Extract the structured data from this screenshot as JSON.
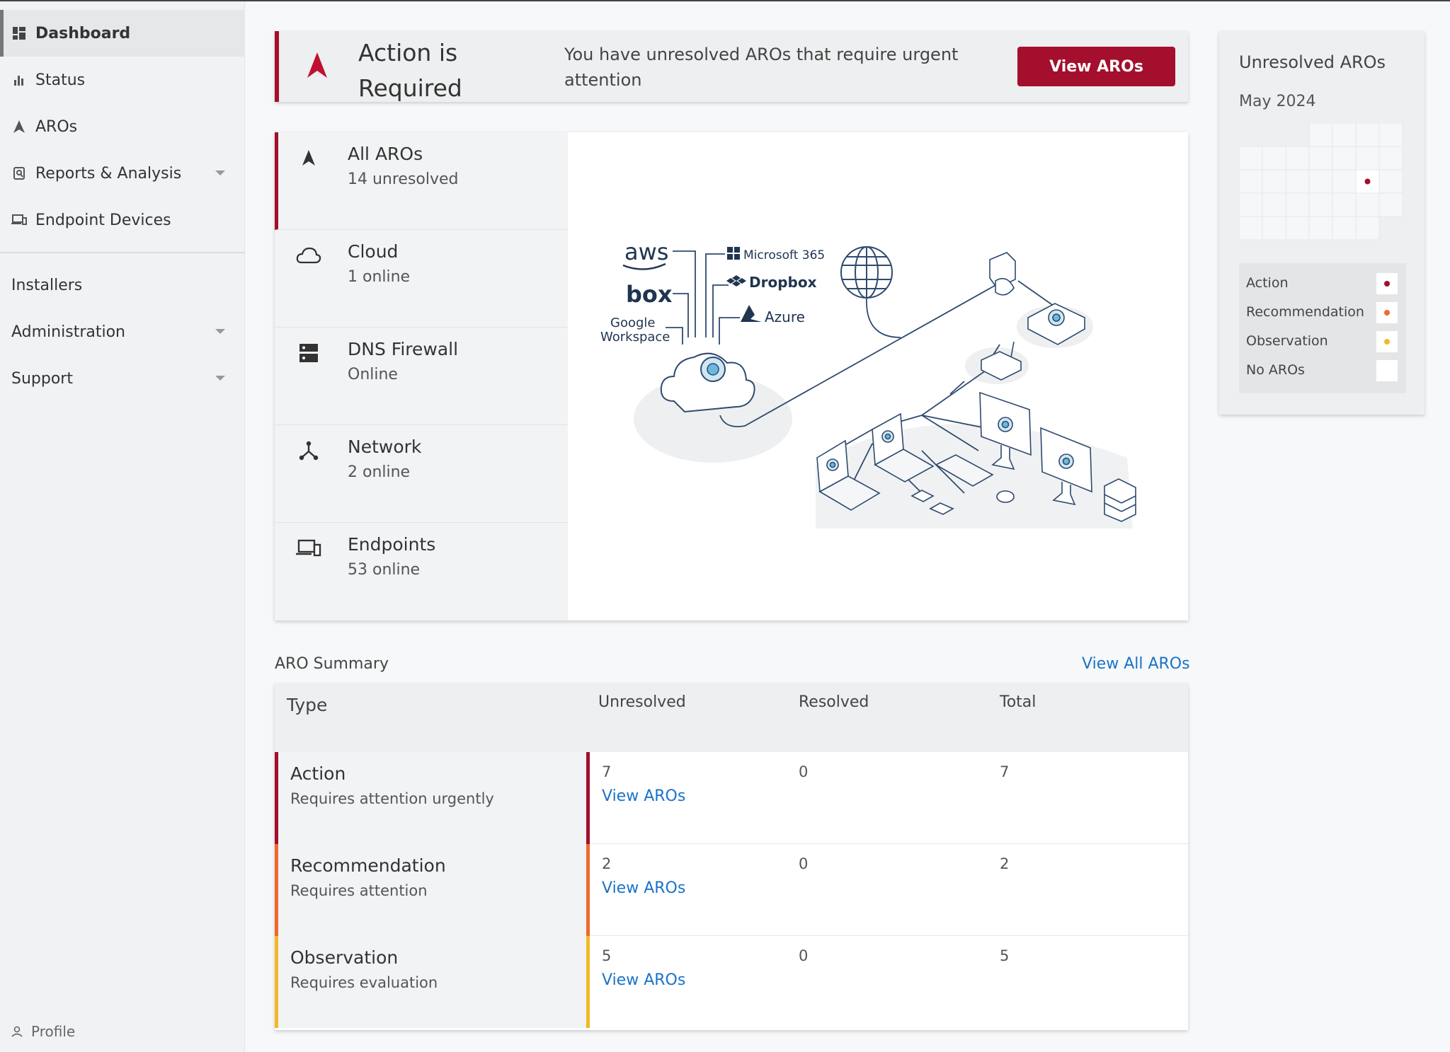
{
  "sidebar": {
    "items": [
      {
        "label": "Dashboard",
        "icon": "dashboard-icon"
      },
      {
        "label": "Status",
        "icon": "bar-chart-icon"
      },
      {
        "label": "AROs",
        "icon": "aro-arrow-icon"
      },
      {
        "label": "Reports & Analysis",
        "icon": "report-search-icon"
      },
      {
        "label": "Endpoint Devices",
        "icon": "devices-icon"
      }
    ],
    "secondary": [
      {
        "label": "Installers"
      },
      {
        "label": "Administration"
      },
      {
        "label": "Support"
      }
    ],
    "profile_label": "Profile"
  },
  "alert": {
    "title": "Action is Required",
    "message": "You have unresolved AROs that require urgent attention",
    "button_label": "View AROs",
    "accent": "#a30f2d"
  },
  "status": {
    "items": [
      {
        "title": "All AROs",
        "sub": "14 unresolved",
        "icon": "aro-arrow-icon"
      },
      {
        "title": "Cloud",
        "sub": "1 online",
        "icon": "cloud-icon"
      },
      {
        "title": "DNS Firewall",
        "sub": "Online",
        "icon": "server-icon"
      },
      {
        "title": "Network",
        "sub": "2 online",
        "icon": "network-icon"
      },
      {
        "title": "Endpoints",
        "sub": "53 online",
        "icon": "devices-icon"
      }
    ]
  },
  "illustration": {
    "labels": {
      "aws": "aws",
      "box": "box",
      "google": "Google",
      "workspace": "Workspace",
      "ms365": "Microsoft 365",
      "dropbox": "Dropbox",
      "azure": "Azure"
    }
  },
  "calendar": {
    "title": "Unresolved AROs",
    "month": "May 2024",
    "legend": [
      {
        "label": "Action",
        "color": "#a30f2d"
      },
      {
        "label": "Recommendation",
        "color": "#ef6a2e"
      },
      {
        "label": "Observation",
        "color": "#f2b928"
      },
      {
        "label": "No AROs",
        "color": ""
      }
    ]
  },
  "summary": {
    "title": "ARO Summary",
    "view_all_label": "View All AROs",
    "headers": {
      "type": "Type",
      "unresolved": "Unresolved",
      "resolved": "Resolved",
      "total": "Total"
    },
    "rows": [
      {
        "name": "Action",
        "desc": "Requires attention urgently",
        "unresolved": "7",
        "resolved": "0",
        "total": "7",
        "link": "View AROs",
        "color": "#a30f2d"
      },
      {
        "name": "Recommendation",
        "desc": "Requires attention",
        "unresolved": "2",
        "resolved": "0",
        "total": "2",
        "link": "View AROs",
        "color": "#ef6a2e"
      },
      {
        "name": "Observation",
        "desc": "Requires evaluation",
        "unresolved": "5",
        "resolved": "0",
        "total": "5",
        "link": "View AROs",
        "color": "#f2b928"
      }
    ]
  }
}
